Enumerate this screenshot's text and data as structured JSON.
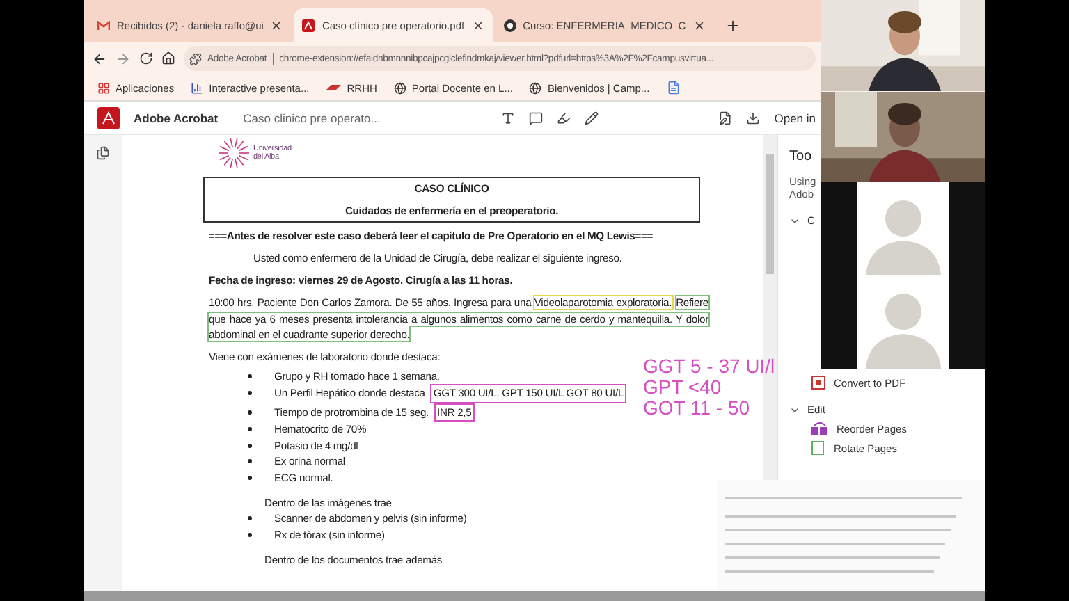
{
  "browser_tabs": [
    {
      "title": "Recibidos (2) - daniela.raffo@ui",
      "kind": "mail",
      "selected": false
    },
    {
      "title": "Caso clínico pre operatorio.pdf",
      "kind": "pdf",
      "selected": true
    },
    {
      "title": "Curso: ENFERMERIA_MEDICO_C",
      "kind": "course",
      "selected": false
    }
  ],
  "address_bar": {
    "site": "Adobe Acrobat",
    "url": "chrome-extension://efaidnbmnnnibpcajpcglclefindmkaj/viewer.html?pdfurl=https%3A%2F%2Fcampusvirtua..."
  },
  "bookmarks": [
    {
      "label": "Aplicaciones",
      "kind": "apps"
    },
    {
      "label": "Interactive presenta...",
      "kind": "chart"
    },
    {
      "label": "RRHH",
      "kind": "brand"
    },
    {
      "label": "Portal Docente en L...",
      "kind": "globe"
    },
    {
      "label": "Bienvenidos | Camp...",
      "kind": "globe"
    },
    {
      "kind": "doc"
    }
  ],
  "acrobat_toolbar": {
    "app": "Adobe Acrobat",
    "file": "Caso clinico pre operato...",
    "open_in": "Open in"
  },
  "document": {
    "logo": "Universidad del Alba",
    "title": "CASO CLÍNICO",
    "subtitle": "Cuidados de enfermería en el preoperatorio.",
    "notice": "===Antes de resolver este caso deberá leer el capítulo de Pre Operatorio en el MQ Lewis===",
    "intro": "Usted como enfermero de la Unidad de Cirugía, debe realizar el siguiente ingreso.",
    "date_line": "Fecha de ingreso: viernes 29 de Agosto. Cirugía a las 11 horas.",
    "case_paragraph": [
      {
        "text": "10:00 hrs. Paciente Don Carlos Zamora. De 55 años. Ingresa para una "
      },
      {
        "text": "Videolaparotomia exploratoria.",
        "color": "#e6d84a"
      },
      {
        "text": "Refiere que hace ya 6 meses presenta intolerancia a algunos alimentos como carne de cerdo y mantequilla. Y dolor abdominal en el cuadrante superior derecho.",
        "color": "#7fc07f"
      }
    ],
    "lab_intro": "Viene con exámenes de laboratorio donde destaca:",
    "lab_items": [
      {
        "text": "Grupo y RH tomado hace 1 semana."
      },
      {
        "text": "Un Perfil Hepático donde destaca",
        "boxed": "GGT 300 UI/L, GPT 150 UI/L GOT 80 UI/L",
        "color": "#d64fc2"
      },
      {
        "text": "Tiempo de protrombina de 15 seg.",
        "boxed": "INR 2,5",
        "color": "#d64fc2"
      },
      {
        "text": "Hematocrito de 70%"
      },
      {
        "text": "Potasio de 4 mg/dl"
      },
      {
        "text": "Ex orina normal"
      },
      {
        "text": "ECG normal."
      }
    ],
    "images_intro": "Dentro de las imágenes trae",
    "image_items": [
      "Scanner de abdomen y pelvis (sin informe)",
      "Rx de tórax (sin informe)"
    ],
    "documents_intro": "Dentro de los documentos trae además"
  },
  "handwritten_notes": [
    "GGT 5 - 37 UI/l",
    "GPT <40",
    "GOT 11 - 50"
  ],
  "tools_panel": {
    "title": "Too",
    "description": [
      "Using",
      "Adob"
    ],
    "sections": [
      {
        "label": "C",
        "expanded": true,
        "items": [
          {
            "label": "Convert to PDF",
            "kind": "convert"
          }
        ]
      },
      {
        "label": "Edit",
        "expanded": true,
        "items": [
          {
            "label": "Reorder Pages",
            "kind": "reorder"
          },
          {
            "label": "Rotate Pages",
            "kind": "rotate"
          }
        ]
      }
    ]
  },
  "video_call": {
    "tiles": [
      {
        "kind": "camera"
      },
      {
        "kind": "camera"
      },
      {
        "kind": "avatar"
      },
      {
        "kind": "avatar"
      }
    ]
  }
}
